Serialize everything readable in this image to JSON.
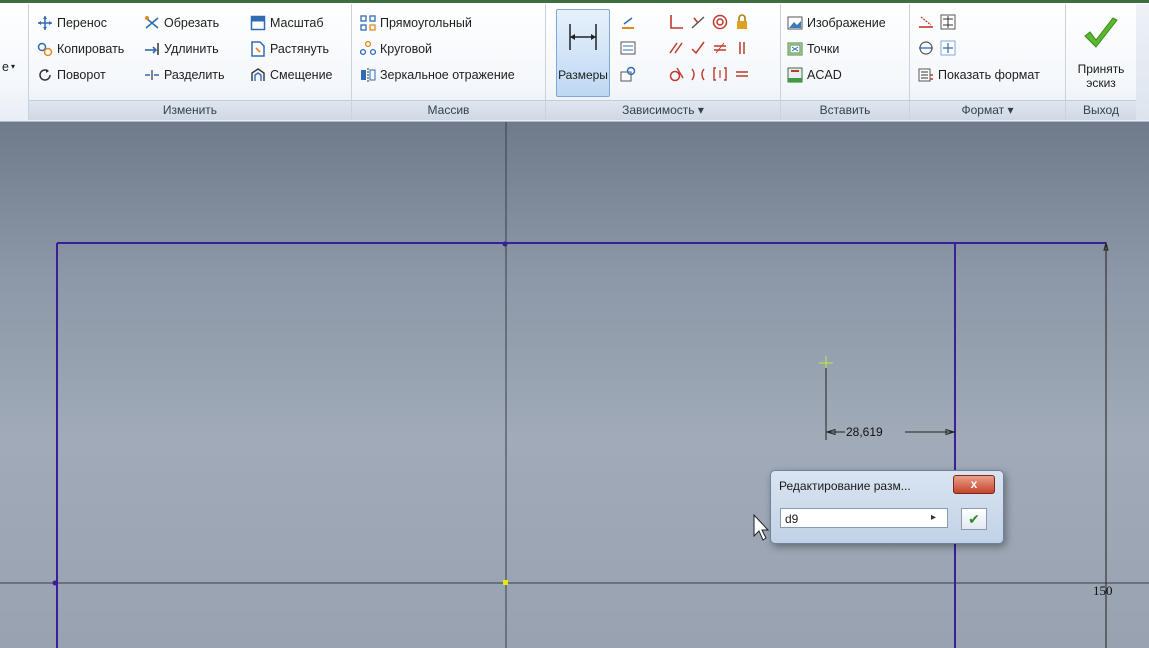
{
  "ribbon": {
    "modify": {
      "title": "Изменить",
      "move": "Перенос",
      "copy": "Копировать",
      "rotate": "Поворот",
      "trim": "Обрезать",
      "extend": "Удлинить",
      "split": "Разделить",
      "scale": "Масштаб",
      "stretch": "Растянуть",
      "offset": "Смещение"
    },
    "pattern": {
      "title": "Массив",
      "rectangular": "Прямоугольный",
      "circular": "Круговой",
      "mirror": "Зеркальное отражение"
    },
    "constrain": {
      "title": "Зависимость ▾",
      "dimension": "Размеры"
    },
    "insert": {
      "title": "Вставить",
      "image": "Изображение",
      "points": "Точки",
      "acad": "ACAD"
    },
    "format": {
      "title": "Формат ▾",
      "show_format": "Показать формат"
    },
    "exit": {
      "title": "Выход",
      "finish_line1": "Принять",
      "finish_line2": "эскиз"
    },
    "left_cut": "е"
  },
  "canvas": {
    "dimension_value": "28,619",
    "side_dimension": "150"
  },
  "dialog": {
    "title": "Редактирование разм...",
    "close": "x",
    "input_value": "d9",
    "arrow": "▸",
    "ok": "✔"
  },
  "colors": {
    "sketch_line": "#3a1f9a",
    "axis_line": "#3a3f48",
    "accent_green": "#4caf2a"
  }
}
